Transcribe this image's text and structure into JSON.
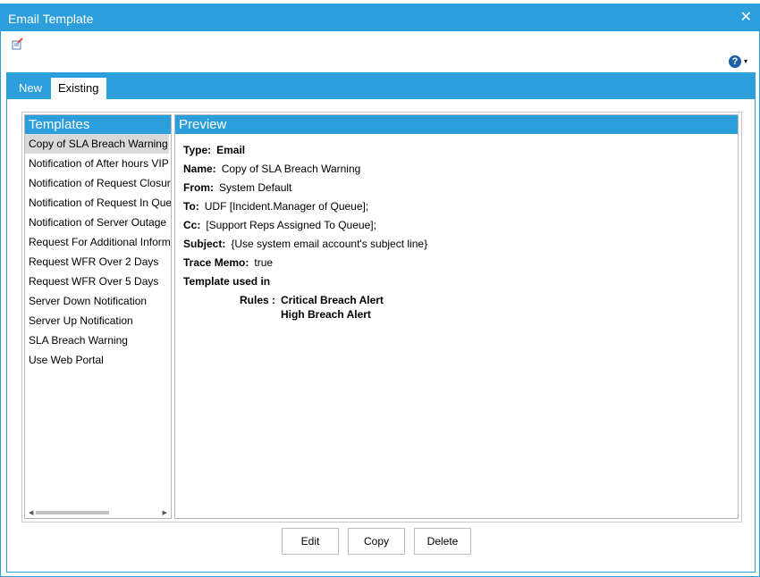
{
  "window": {
    "title": "Email Template",
    "close_glyph": "✕"
  },
  "toolbar": {
    "icon": "edit-document-icon",
    "help_glyph": "?",
    "help_caret": "▾"
  },
  "tabs": [
    {
      "label": "New",
      "active": false
    },
    {
      "label": "Existing",
      "active": true
    }
  ],
  "templates": {
    "header": "Templates",
    "items": [
      "Copy of SLA Breach Warning",
      "Notification of After hours VIP",
      "Notification of Request Closure",
      "Notification of Request In Queue",
      "Notification of Server Outage",
      "Request For Additional Information",
      "Request WFR Over 2 Days",
      "Request WFR Over 5 Days",
      "Server Down Notification",
      "Server Up Notification",
      "SLA Breach Warning",
      "Use Web Portal"
    ],
    "selected_index": 0
  },
  "preview": {
    "header": "Preview",
    "type_label": "Type:",
    "type_value": "Email",
    "name_label": "Name:",
    "name_value": "Copy of SLA Breach Warning",
    "from_label": "From:",
    "from_value": "System Default",
    "to_label": "To:",
    "to_value": "UDF [Incident.Manager of Queue];",
    "cc_label": "Cc:",
    "cc_value": "[Support Reps Assigned To Queue];",
    "subject_label": "Subject:",
    "subject_value": "{Use system email account's subject line}",
    "trace_label": "Trace Memo:",
    "trace_value": "true",
    "used_in_label": "Template used in",
    "rules_label": "Rules :",
    "rules": [
      "Critical Breach Alert",
      "High Breach Alert"
    ]
  },
  "buttons": {
    "edit": "Edit",
    "copy": "Copy",
    "delete": "Delete"
  },
  "colors": {
    "accent": "#2b9edb",
    "selected_row": "#d9d9d9"
  }
}
